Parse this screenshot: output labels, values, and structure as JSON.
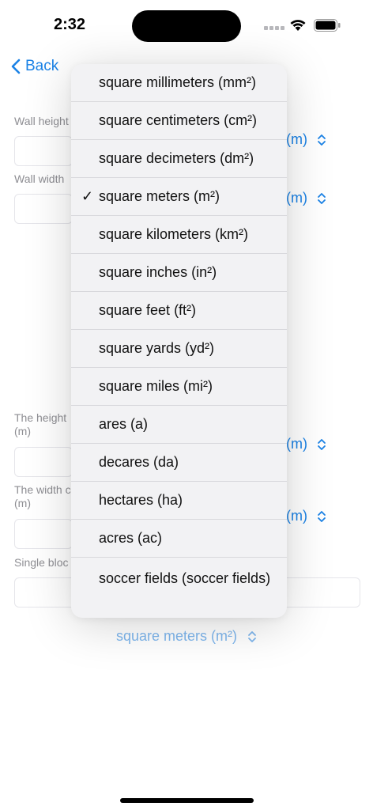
{
  "status_bar": {
    "time": "2:32"
  },
  "nav": {
    "back_label": "Back"
  },
  "form": {
    "wall_height_label": "Wall height",
    "wall_width_label": "Wall width",
    "block_height_label": "The height",
    "block_height_unit_line": "(m)",
    "block_width_label": "The width c",
    "block_width_unit_line": "(m)",
    "single_block_label": "Single bloc",
    "wall_height_unit": "(m)",
    "wall_width_unit": "(m)",
    "block_height_unit": "(m)",
    "block_width_unit": "(m)",
    "result_unit": "square meters (m²)"
  },
  "menu": {
    "selected_index": 3,
    "check_glyph": "✓",
    "items": [
      {
        "label": "square millimeters (mm²)"
      },
      {
        "label": "square centimeters (cm²)"
      },
      {
        "label": "square decimeters (dm²)"
      },
      {
        "label": "square meters (m²)"
      },
      {
        "label": "square kilometers (km²)"
      },
      {
        "label": "square inches (in²)"
      },
      {
        "label": "square feet (ft²)"
      },
      {
        "label": "square yards (yd²)"
      },
      {
        "label": "square miles (mi²)"
      },
      {
        "label": "ares (a)"
      },
      {
        "label": "decares (da)"
      },
      {
        "label": "hectares (ha)"
      },
      {
        "label": "acres (ac)"
      },
      {
        "label": "soccer fields (soccer fields)"
      }
    ]
  },
  "colors": {
    "accent": "#1a82e6",
    "muted_accent": "#7fb7ee",
    "label_gray": "#8e8e93",
    "menu_bg": "#f2f2f4"
  }
}
